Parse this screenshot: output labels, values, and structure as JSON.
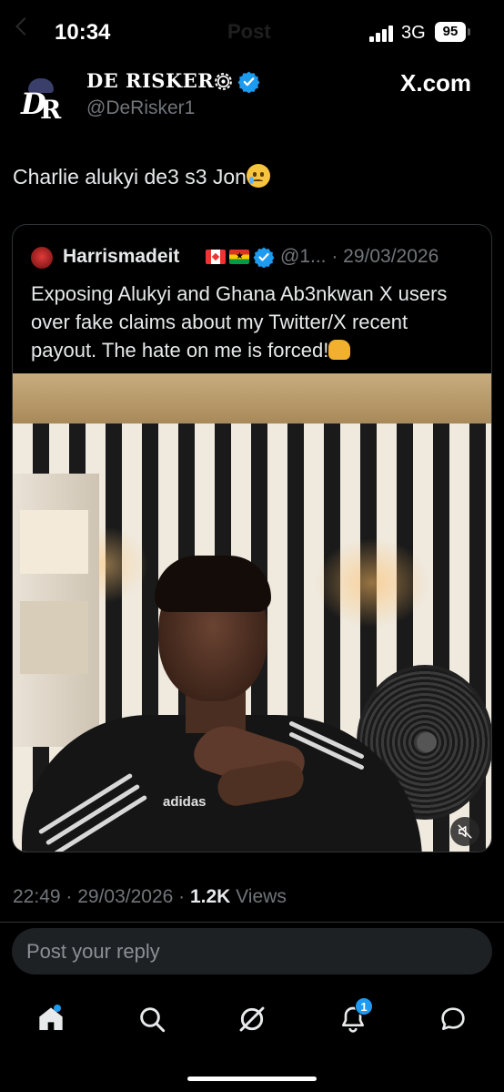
{
  "status_bar": {
    "time": "10:34",
    "ghost_title": "Post",
    "network": "3G",
    "battery": "95"
  },
  "author": {
    "avatar_text_d": "D",
    "avatar_text_r": "R",
    "name": "DE RISKER",
    "handle": "@DeRisker1",
    "watermark": "X.com"
  },
  "tweet": {
    "text": "Charlie alukyi de3 s3 Jon"
  },
  "quote": {
    "name": "Harrismadeit",
    "meta": "@1... · 29/03/2026",
    "text": "Exposing Alukyi and Ghana Ab3nkwan X users over fake claims about my Twitter/X recent payout. The hate on me is forced!",
    "video_brand": "adidas"
  },
  "meta": {
    "time_date": "22:49 · 29/03/2026 · ",
    "views_count": "1.2K",
    "views_label": " Views"
  },
  "reply": {
    "placeholder": "Post your reply"
  },
  "nav": {
    "notification_count": "1"
  },
  "colors": {
    "accent": "#1d9bf0",
    "background": "#000000",
    "secondary_text": "#71767b"
  }
}
